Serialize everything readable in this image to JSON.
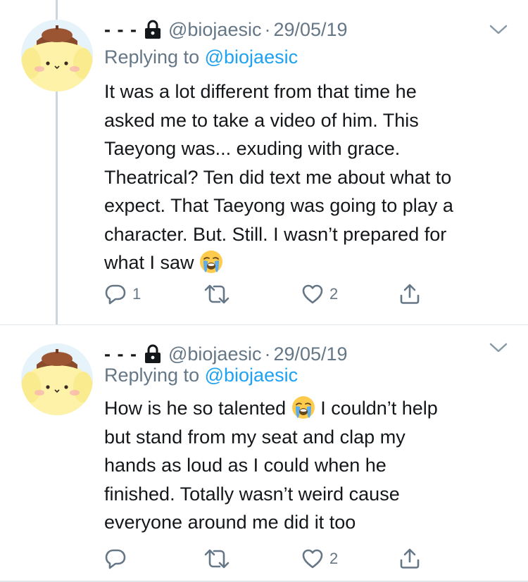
{
  "tweets": [
    {
      "display_name": "- - -",
      "handle": "@biojaesic",
      "date": "29/05/19",
      "replying_label": "Replying to",
      "replying_mention": "@biojaesic",
      "text_lines": [
        "It was a lot different from that time he",
        "asked me to take a video of him. This",
        "Taeyong was... exuding with grace.",
        "Theatrical? Ten did text me about what to",
        "expect. That Taeyong was going to play a",
        "character. But. Still. I wasn’t prepared for",
        "what I saw"
      ],
      "emoji": "loudly-crying-face",
      "reply_count": "1",
      "retweet_count": "",
      "like_count": "2"
    },
    {
      "display_name": "- - -",
      "handle": "@biojaesic",
      "date": "29/05/19",
      "replying_label": "Replying to",
      "replying_mention": "@biojaesic",
      "text_lines": [
        "How is he so talented",
        "I couldn’t help",
        "but stand from my seat and clap my",
        "hands as loud as I could when he",
        "finished. Totally wasn’t weird cause",
        "everyone around me did it too"
      ],
      "emoji": "loudly-crying-face",
      "reply_count": "",
      "retweet_count": "",
      "like_count": "2"
    }
  ],
  "colors": {
    "text": "#14171a",
    "secondary": "#657786",
    "link": "#1da1f2",
    "divider": "#e1e8ed",
    "thread_line": "#ccd6dd"
  },
  "icons": [
    "lock-icon",
    "chevron-down-icon",
    "reply-icon",
    "retweet-icon",
    "like-icon",
    "share-icon",
    "avatar-pompompurin"
  ]
}
